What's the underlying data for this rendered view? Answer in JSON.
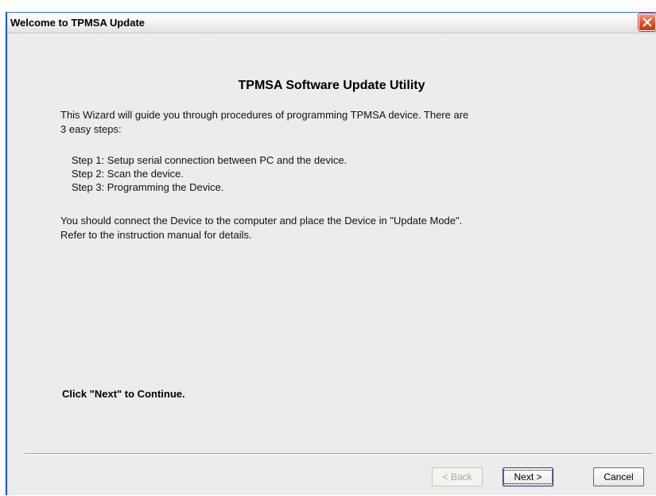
{
  "window": {
    "title": "Welcome to TPMSA Update"
  },
  "content": {
    "heading": "TPMSA Software Update Utility",
    "intro_line1": "This Wizard will guide you through procedures of programming TPMSA device.  There are",
    "intro_line2": "3 easy steps:",
    "steps": [
      "Step 1:  Setup serial connection between PC and the device.",
      "Step 2:  Scan the device.",
      "Step 3:  Programming the Device."
    ],
    "note_line1": "You should connect the Device to the computer and place the Device in \"Update Mode\".",
    "note_line2": "Refer to the instruction manual for details.",
    "call_to_action": "Click \"Next\" to Continue."
  },
  "buttons": {
    "back_label": "< Back",
    "next_label": "Next >",
    "cancel_label": "Cancel",
    "back_enabled": false
  },
  "colors": {
    "window_bg": "#ececec",
    "close_button": "#e2552e"
  },
  "icons": {
    "close": "close-icon"
  }
}
